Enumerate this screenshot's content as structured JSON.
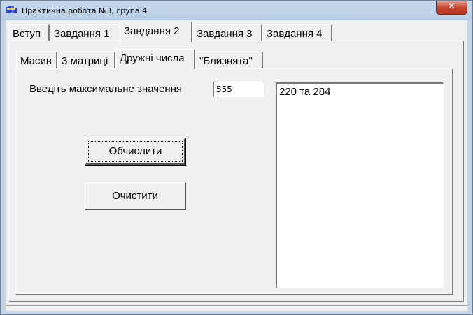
{
  "window": {
    "title": "Практична робота №3, група 4",
    "close_glyph": "✕"
  },
  "main_tabs": [
    {
      "label": "Вступ"
    },
    {
      "label": "Завдання 1"
    },
    {
      "label": "Завдання 2"
    },
    {
      "label": "Завдання 3"
    },
    {
      "label": "Завдання 4"
    }
  ],
  "sub_tabs": [
    {
      "label": "Масив"
    },
    {
      "label": "3 матриці"
    },
    {
      "label": "Дружні числа"
    },
    {
      "label": "\"Близнята\""
    }
  ],
  "form": {
    "max_label": "Введіть максимальне значення",
    "max_value": "555",
    "calc_button": "Обчислити",
    "clear_button": "Очистити",
    "output_text": "220 та 284"
  },
  "colors": {
    "title_bar": "#c4d5e8",
    "close_button": "#c7462f",
    "face": "#f0f0f0"
  },
  "icons": {
    "app": "delphi-app-icon",
    "close": "close-icon"
  }
}
